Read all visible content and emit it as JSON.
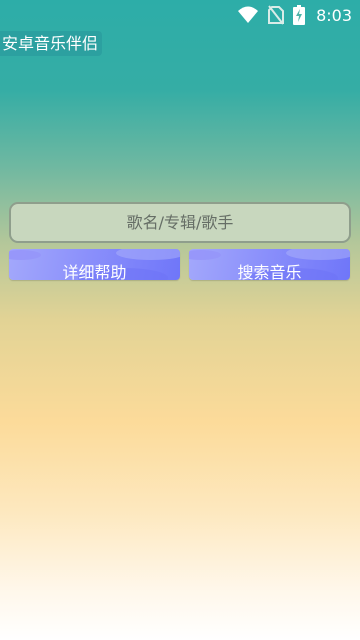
{
  "status_bar": {
    "time": "8:03",
    "icons": [
      "wifi-icon",
      "no-sim-icon",
      "battery-charging-icon"
    ]
  },
  "app": {
    "title": "安卓音乐伴侣"
  },
  "search": {
    "placeholder": "歌名/专辑/歌手"
  },
  "buttons": {
    "left_label": "详细帮助",
    "right_label": "搜索音乐"
  },
  "colors": {
    "background_top": "#2dada8",
    "background_middle": "#fcdb9a",
    "background_bottom": "#ffffff",
    "input_background": "#c8d7be",
    "button_accent": "#8b90fb"
  }
}
